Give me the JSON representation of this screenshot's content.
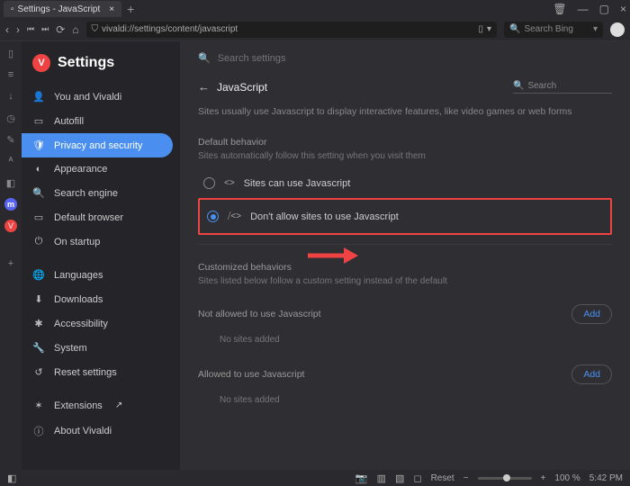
{
  "titlebar": {
    "tab_title": "Settings - JavaScript"
  },
  "navbar": {
    "url": "vivaldi://settings/content/javascript",
    "search_placeholder": "Search Bing"
  },
  "sidebar": {
    "header": "Settings",
    "items": [
      {
        "icon": "person",
        "label": "You and Vivaldi"
      },
      {
        "icon": "autofill",
        "label": "Autofill"
      },
      {
        "icon": "shield",
        "label": "Privacy and security",
        "active": true
      },
      {
        "icon": "appearance",
        "label": "Appearance"
      },
      {
        "icon": "search",
        "label": "Search engine"
      },
      {
        "icon": "default",
        "label": "Default browser"
      },
      {
        "icon": "startup",
        "label": "On startup"
      }
    ],
    "items2": [
      {
        "icon": "globe",
        "label": "Languages"
      },
      {
        "icon": "download",
        "label": "Downloads"
      },
      {
        "icon": "access",
        "label": "Accessibility"
      },
      {
        "icon": "system",
        "label": "System"
      },
      {
        "icon": "reset",
        "label": "Reset settings"
      }
    ],
    "items3": [
      {
        "icon": "ext",
        "label": "Extensions",
        "external": true
      },
      {
        "icon": "about",
        "label": "About Vivaldi"
      }
    ]
  },
  "content": {
    "search_placeholder": "Search settings",
    "page_title": "JavaScript",
    "search_right": "Search",
    "intro": "Sites usually use Javascript to display interactive features, like video games or web forms",
    "default_label": "Default behavior",
    "default_sub": "Sites automatically follow this setting when you visit them",
    "radio_allow": "Sites can use Javascript",
    "radio_block": "Don't allow sites to use Javascript",
    "custom_label": "Customized behaviors",
    "custom_sub": "Sites listed below follow a custom setting instead of the default",
    "not_allowed_label": "Not allowed to use Javascript",
    "allowed_label": "Allowed to use Javascript",
    "no_sites": "No sites added",
    "add_btn": "Add"
  },
  "statusbar": {
    "reset": "Reset",
    "zoom": "100 %",
    "time": "5:42 PM"
  }
}
